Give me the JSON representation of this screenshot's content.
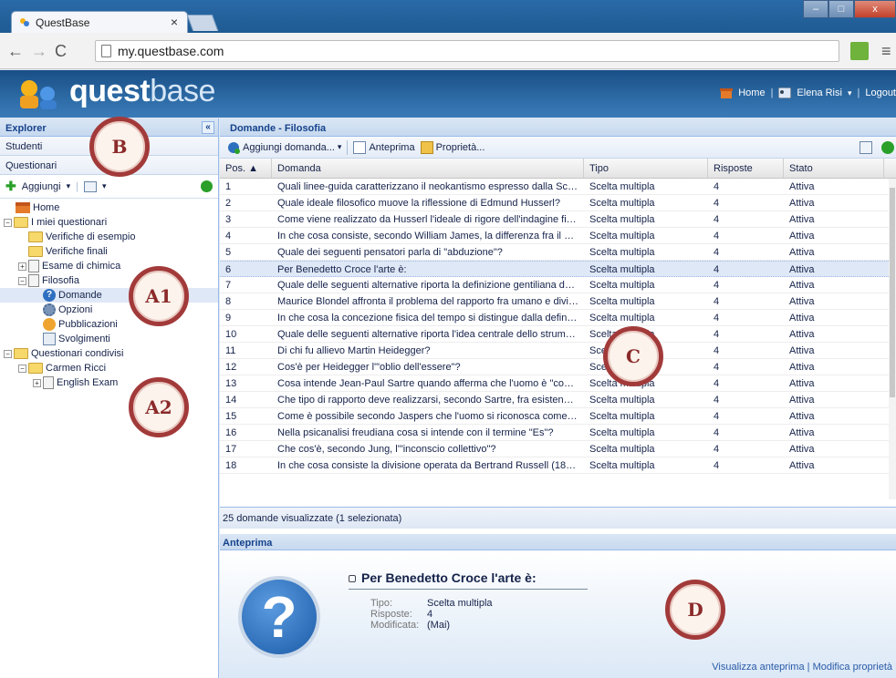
{
  "browser": {
    "tab_title": "QuestBase",
    "tab_close": "×",
    "url": "my.questbase.com",
    "minimize": "–",
    "maximize": "□",
    "close": "x"
  },
  "app": {
    "logo_bold": "quest",
    "logo_thin": "base",
    "home_link": "Home",
    "user_link": "Elena Risi",
    "logout_link": "Logout"
  },
  "explorer": {
    "title": "Explorer",
    "collapse": "«",
    "accordion": [
      "Studenti",
      "Questionari"
    ],
    "add_button": "Aggiungi",
    "tree": {
      "home": "Home",
      "my": "I miei questionari",
      "verifiche_esempio": "Verifiche di esempio",
      "verifiche_finali": "Verifiche finali",
      "chimica": "Esame di chimica",
      "filosofia": "Filosofia",
      "domande": "Domande",
      "opzioni": "Opzioni",
      "pubblicazioni": "Pubblicazioni",
      "svolgimenti": "Svolgimenti",
      "condivisi": "Questionari condivisi",
      "carmen": "Carmen Ricci",
      "english": "English Exam"
    }
  },
  "main": {
    "title": "Domande - Filosofia",
    "toolbar": {
      "add": "Aggiungi domanda...",
      "preview": "Anteprima",
      "props": "Proprietà..."
    },
    "columns": [
      "Pos. ▲",
      "Domanda",
      "Tipo",
      "Risposte",
      "Stato"
    ],
    "rows": [
      [
        "1",
        "Quali linee-guida caratterizzano il neokantismo espresso dalla Scuola ...",
        "Scelta multipla",
        "4",
        "Attiva"
      ],
      [
        "2",
        "Quale ideale filosofico muove la riflessione di Edmund Husserl?",
        "Scelta multipla",
        "4",
        "Attiva"
      ],
      [
        "3",
        "Come viene realizzato da Husserl l'ideale di rigore dell'indagine filosofi...",
        "Scelta multipla",
        "4",
        "Attiva"
      ],
      [
        "4",
        "In che cosa consiste, secondo William James, la differenza fra il suo ...",
        "Scelta multipla",
        "4",
        "Attiva"
      ],
      [
        "5",
        "Quale dei seguenti pensatori parla di \"abduzione\"?",
        "Scelta multipla",
        "4",
        "Attiva"
      ],
      [
        "6",
        "Per Benedetto Croce l'arte è:",
        "Scelta multipla",
        "4",
        "Attiva"
      ],
      [
        "7",
        "Quale delle seguenti alternative riporta la definizione gentiliana della r...",
        "Scelta multipla",
        "4",
        "Attiva"
      ],
      [
        "8",
        "Maurice Blondel affronta il problema del rapporto fra umano e divino i...",
        "Scelta multipla",
        "4",
        "Attiva"
      ],
      [
        "9",
        "In che cosa la concezione fisica del tempo si distingue dalla definizion...",
        "Scelta multipla",
        "4",
        "Attiva"
      ],
      [
        "10",
        "Quale delle seguenti alternative riporta l'idea centrale dello strumentali...",
        "Scelta multipla",
        "4",
        "Attiva"
      ],
      [
        "11",
        "Di chi fu allievo Martin Heidegger?",
        "Scelta multipla",
        "4",
        "Attiva"
      ],
      [
        "12",
        "Cos'è per Heidegger l'\"oblio dell'essere\"?",
        "Scelta multipla",
        "4",
        "Attiva"
      ],
      [
        "13",
        "Cosa intende Jean-Paul Sartre quando afferma che l'uomo è \"condan...",
        "Scelta multipla",
        "4",
        "Attiva"
      ],
      [
        "14",
        "Che tipo di rapporto deve realizzarsi, secondo Sartre, fra esistenziali...",
        "Scelta multipla",
        "4",
        "Attiva"
      ],
      [
        "15",
        "Come è possibile secondo Jaspers che l'uomo si riconosca come esi...",
        "Scelta multipla",
        "4",
        "Attiva"
      ],
      [
        "16",
        "Nella psicanalisi freudiana cosa si intende con il termine \"Es\"?",
        "Scelta multipla",
        "4",
        "Attiva"
      ],
      [
        "17",
        "Che cos'è, secondo Jung, l'\"inconscio collettivo\"?",
        "Scelta multipla",
        "4",
        "Attiva"
      ],
      [
        "18",
        "In che cosa consiste la divisione operata da Bertrand Russell (1872-1...",
        "Scelta multipla",
        "4",
        "Attiva"
      ]
    ],
    "status": "25 domande visualizzate (1 selezionata)"
  },
  "preview": {
    "title": "Anteprima",
    "question": "Per Benedetto Croce l'arte è:",
    "tipo_label": "Tipo:",
    "tipo_value": "Scelta multipla",
    "risposte_label": "Risposte:",
    "risposte_value": "4",
    "modificata_label": "Modificata:",
    "modificata_value": "(Mai)",
    "link_preview": "Visualizza anteprima",
    "link_sep": "|",
    "link_props": "Modifica proprietà"
  },
  "badges": {
    "b": "B",
    "a1": "A1",
    "a2": "A2",
    "c": "C",
    "d": "D"
  }
}
